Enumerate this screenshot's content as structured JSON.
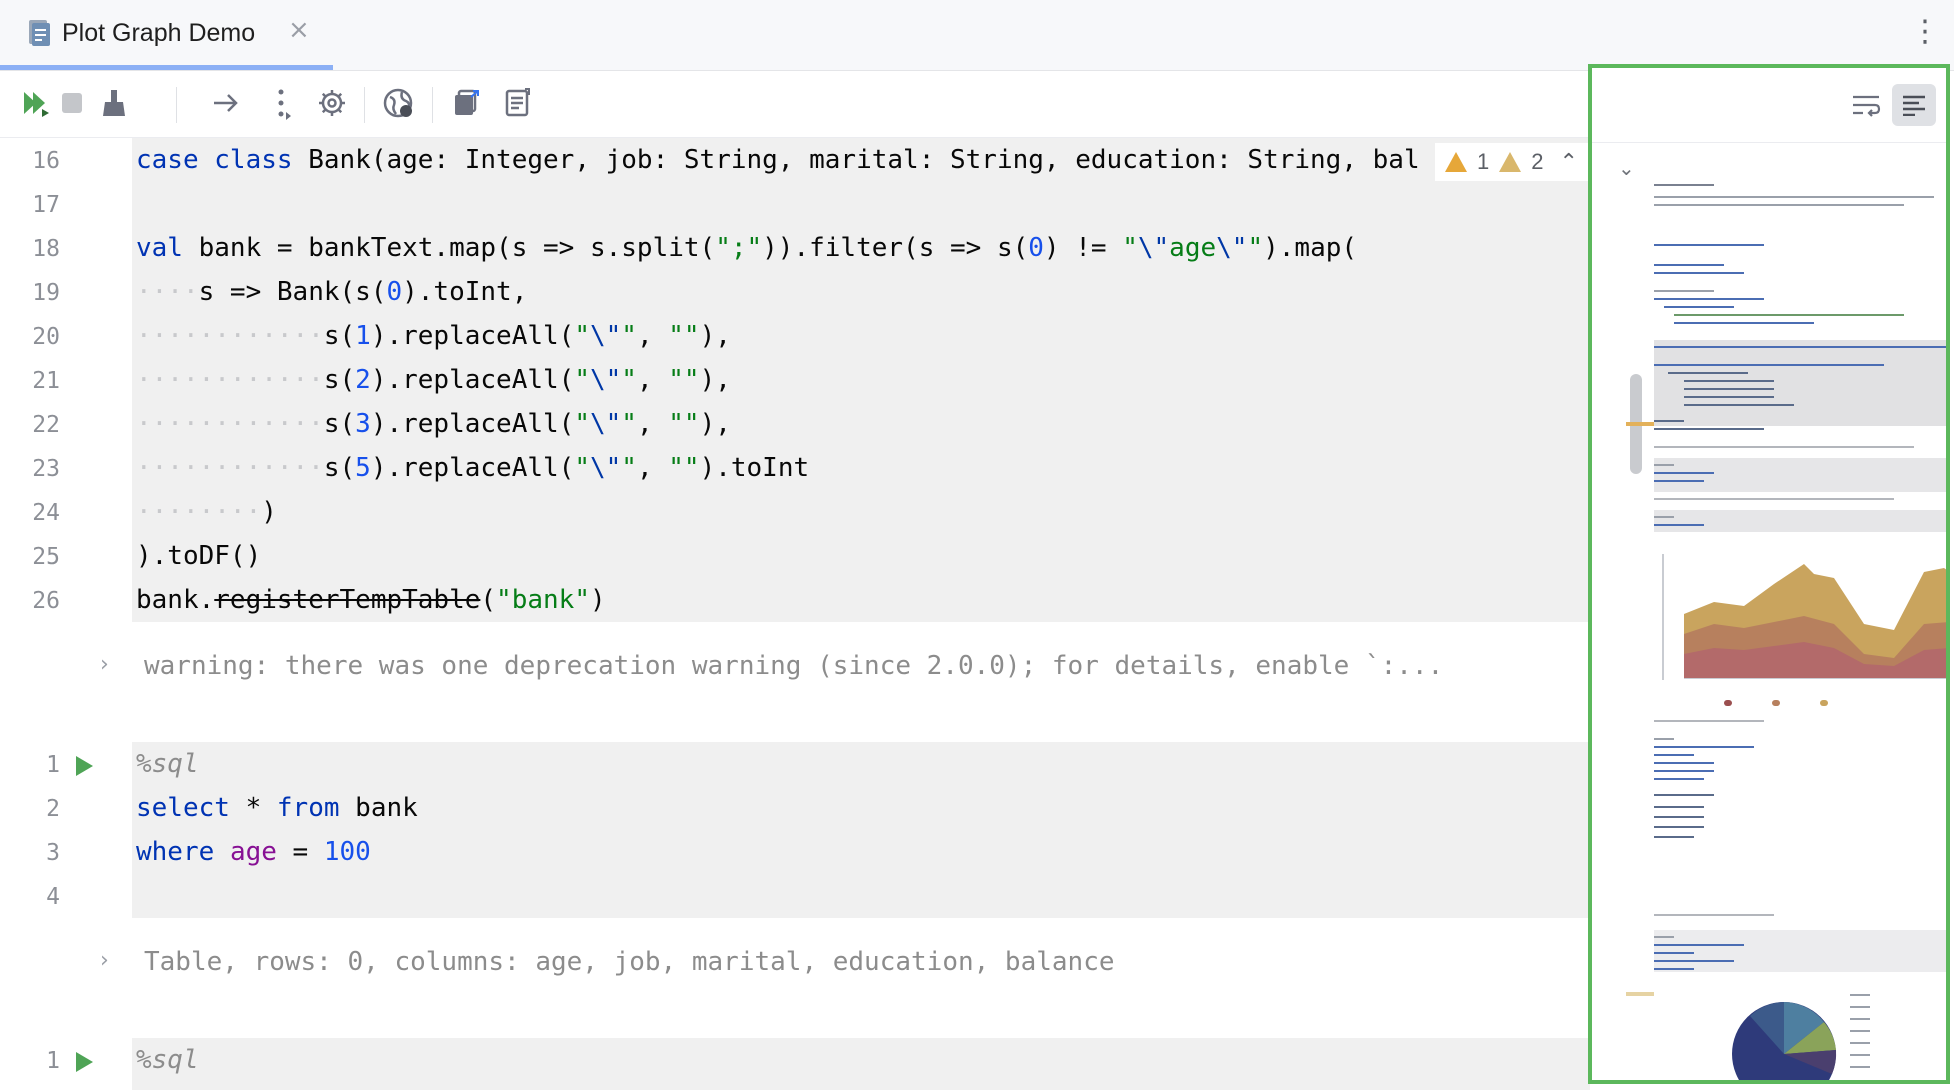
{
  "tab": {
    "title": "Plot Graph Demo",
    "close_glyph": "×"
  },
  "window": {
    "more_glyph": "⋮"
  },
  "toolbar": {
    "icons": [
      "run-all-icon",
      "stop-icon",
      "clear-outputs-icon",
      "arrow-right-icon",
      "more-vertical-icon",
      "settings-icon",
      "globe-icon",
      "export-icon",
      "notes-icon"
    ]
  },
  "inspection": {
    "warnings": "1",
    "weak_warnings": "2"
  },
  "editor": {
    "cell1": {
      "line_numbers": [
        "16",
        "17",
        "18",
        "19",
        "20",
        "21",
        "22",
        "23",
        "24",
        "25",
        "26"
      ],
      "output": "warning: there was one deprecation warning (since 2.0.0); for details, enable `:..."
    },
    "cell2": {
      "line_numbers": [
        "1",
        "2",
        "3",
        "4"
      ],
      "magic": "%sql",
      "line2": {
        "kw1": "select",
        "star": " * ",
        "kw2": "from",
        "rest": " bank"
      },
      "line3": {
        "kw": "where",
        "field": "age",
        "op": " = ",
        "num": "100"
      },
      "output": "Table, rows: 0, columns: age, job, marital, education, balance"
    },
    "cell3": {
      "line_numbers": [
        "1"
      ],
      "magic": "%sql"
    }
  },
  "minimap": {
    "soft_wrap_icon": "soft-wrap-icon",
    "structure_icon": "structure-icon",
    "accent": "#5cb85c"
  }
}
